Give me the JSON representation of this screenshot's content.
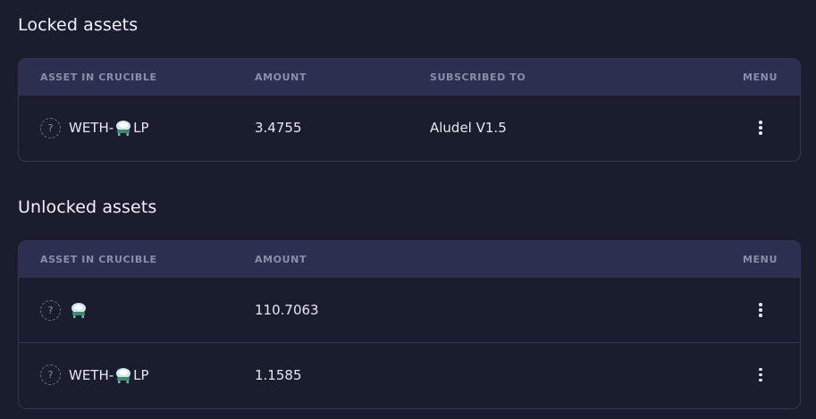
{
  "colors": {
    "background": "#1a1d2e",
    "header_bg": "#2c3050",
    "border": "#33374d",
    "header_text": "#8a8fa8",
    "text": "#e6e8f0"
  },
  "locked": {
    "title": "Locked assets",
    "columns": {
      "asset": "ASSET IN CRUCIBLE",
      "amount": "AMOUNT",
      "subscribed": "SUBSCRIBED TO",
      "menu": "MENU"
    },
    "rows": [
      {
        "name_prefix": "WETH-",
        "name_suffix": "LP",
        "token_icon": "alembic-icon",
        "amount": "3.4755",
        "subscribed": "Aludel V1.5"
      }
    ]
  },
  "unlocked": {
    "title": "Unlocked assets",
    "columns": {
      "asset": "ASSET IN CRUCIBLE",
      "amount": "AMOUNT",
      "menu": "MENU"
    },
    "rows": [
      {
        "name_prefix": "",
        "name_suffix": "",
        "token_icon": "alembic-icon",
        "amount": "110.7063"
      },
      {
        "name_prefix": "WETH-",
        "name_suffix": "LP",
        "token_icon": "alembic-icon",
        "amount": "1.1585"
      }
    ]
  },
  "icons": {
    "unknown": "?"
  }
}
